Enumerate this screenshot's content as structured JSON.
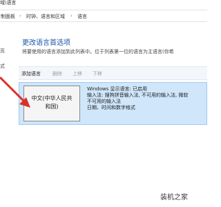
{
  "window": {
    "title_fragment": "域\\语言"
  },
  "breadcrumb": {
    "items": [
      "制面板",
      "时钟、语言和区域",
      "语言"
    ],
    "separator": "›"
  },
  "sidebar": {
    "fragments": [
      "页",
      "式"
    ]
  },
  "page": {
    "title": "更改语言首选项",
    "description": "将要使用的语言添加到此列表中。位于列表第一位的语言为主语言(你希"
  },
  "toolbar": {
    "add_language": "添加语言",
    "remove": "删除",
    "move_up": "上移",
    "move_down": "下移"
  },
  "languages": [
    {
      "name_line1": "中文(中华人民共",
      "name_line2": "和国)",
      "details": [
        "Windows 显示语言: 已启用",
        "输入法: 搜狗拼音输入法, 不可用的输入法, 微软",
        "不可用的输入法",
        "日期、时间和数字格式"
      ]
    }
  ],
  "colors": {
    "accent_title": "#1a56a8",
    "selected_row": "#cfe6fb",
    "annotation_arrow": "#d9322a"
  },
  "watermark": {
    "text": "装机之家"
  }
}
